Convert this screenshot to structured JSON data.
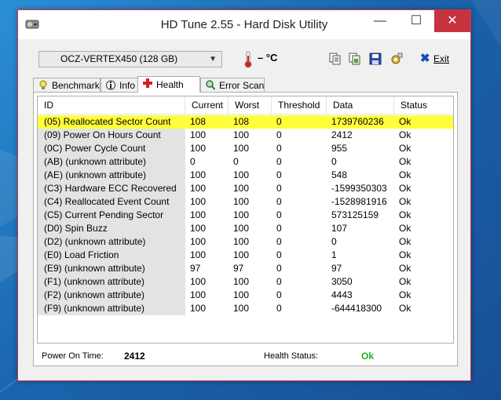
{
  "window": {
    "title": "HD Tune 2.55 - Hard Disk Utility"
  },
  "toolbar": {
    "drive": "OCZ-VERTEX450 (128 GB)",
    "temperature": "– °C",
    "exit_label": "Exit"
  },
  "tabs": [
    {
      "label": "Benchmark",
      "active": false
    },
    {
      "label": "Info",
      "active": false
    },
    {
      "label": "Health",
      "active": true
    },
    {
      "label": "Error Scan",
      "active": false
    }
  ],
  "table": {
    "columns": [
      "ID",
      "Current",
      "Worst",
      "Threshold",
      "Data",
      "Status"
    ],
    "rows": [
      [
        "(05) Reallocated Sector Count",
        "108",
        "108",
        "0",
        "1739760236",
        "Ok"
      ],
      [
        "(09) Power On Hours Count",
        "100",
        "100",
        "0",
        "2412",
        "Ok"
      ],
      [
        "(0C) Power Cycle Count",
        "100",
        "100",
        "0",
        "955",
        "Ok"
      ],
      [
        "(AB) (unknown attribute)",
        "0",
        "0",
        "0",
        "0",
        "Ok"
      ],
      [
        "(AE) (unknown attribute)",
        "100",
        "100",
        "0",
        "548",
        "Ok"
      ],
      [
        "(C3) Hardware ECC Recovered",
        "100",
        "100",
        "0",
        "-1599350303",
        "Ok"
      ],
      [
        "(C4) Reallocated Event Count",
        "100",
        "100",
        "0",
        "-1528981916",
        "Ok"
      ],
      [
        "(C5) Current Pending Sector",
        "100",
        "100",
        "0",
        "573125159",
        "Ok"
      ],
      [
        "(D0) Spin Buzz",
        "100",
        "100",
        "0",
        "107",
        "Ok"
      ],
      [
        "(D2) (unknown attribute)",
        "100",
        "100",
        "0",
        "0",
        "Ok"
      ],
      [
        "(E0) Load Friction",
        "100",
        "100",
        "0",
        "1",
        "Ok"
      ],
      [
        "(E9) (unknown attribute)",
        "97",
        "97",
        "0",
        "97",
        "Ok"
      ],
      [
        "(F1) (unknown attribute)",
        "100",
        "100",
        "0",
        "3050",
        "Ok"
      ],
      [
        "(F2) (unknown attribute)",
        "100",
        "100",
        "0",
        "4443",
        "Ok"
      ],
      [
        "(F9) (unknown attribute)",
        "100",
        "100",
        "0",
        "-644418300",
        "Ok"
      ]
    ],
    "selected_row": 0,
    "selected_color": "#ffff3c"
  },
  "footer": {
    "power_on_label": "Power On Time:",
    "power_on_value": "2412",
    "health_label": "Health Status:",
    "health_value": "Ok",
    "health_color": "#22b022"
  },
  "icons": {
    "toolbar": [
      "copy-text-icon",
      "copy-screenshot-icon",
      "save-icon",
      "options-icon"
    ]
  }
}
